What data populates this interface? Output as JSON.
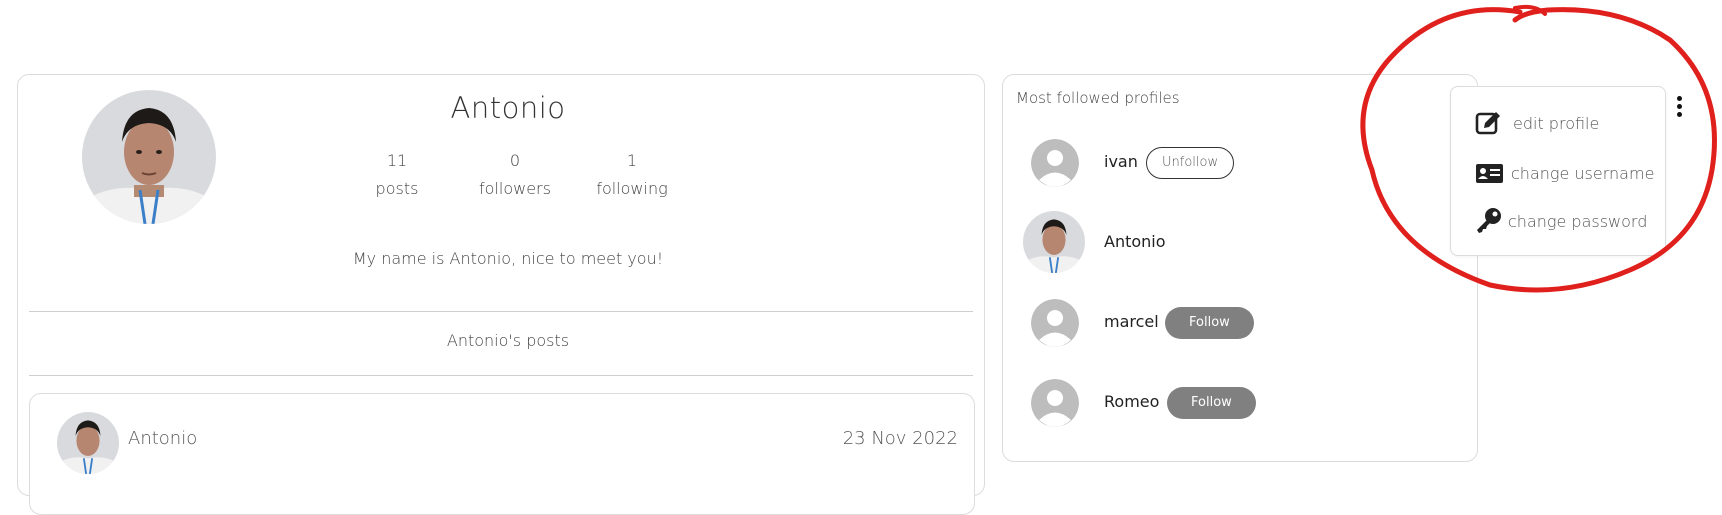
{
  "profile": {
    "username": "Antonio",
    "stats": [
      {
        "value": "11",
        "label": "posts"
      },
      {
        "value": "0",
        "label": "followers"
      },
      {
        "value": "1",
        "label": "following"
      }
    ],
    "bio": "My name is Antonio, nice to meet you!",
    "posts_heading": "Antonio's posts"
  },
  "post": {
    "author": "Antonio",
    "date": "23 Nov 2022"
  },
  "most_followed": {
    "title": "Most followed profiles",
    "users": [
      {
        "name": "ivan",
        "button": "Unfollow",
        "avatar": "default-avatar-icon"
      },
      {
        "name": "Antonio",
        "button": "",
        "avatar": "photo"
      },
      {
        "name": "marcel",
        "button": "Follow",
        "avatar": "default-avatar-icon"
      },
      {
        "name": "Romeo",
        "button": "Follow",
        "avatar": "default-avatar-icon"
      }
    ]
  },
  "menu": {
    "items": [
      {
        "label": "edit profile",
        "icon": "edit-icon"
      },
      {
        "label": "change username",
        "icon": "id-card-icon"
      },
      {
        "label": "change password",
        "icon": "key-icon"
      }
    ],
    "toggle_icon": "kebab-menu-icon"
  },
  "colors": {
    "annotation": "#e0201c",
    "follow_button": "#808080",
    "border": "#dcdcdc"
  }
}
